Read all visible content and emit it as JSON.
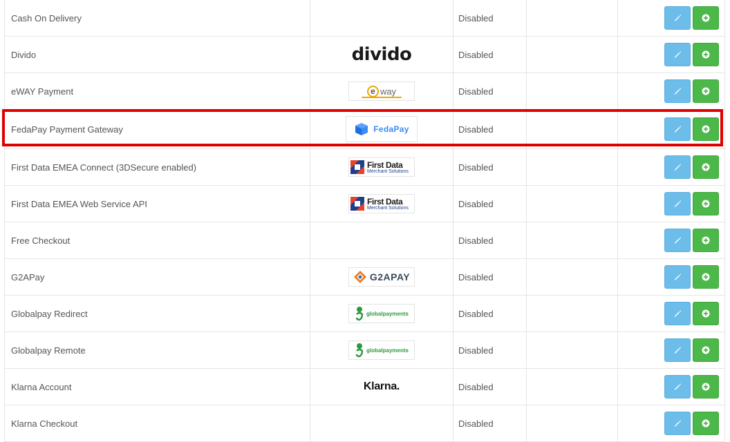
{
  "colors": {
    "edit_button": "#6cbde9",
    "install_button": "#4cb849",
    "highlight": "#e00000"
  },
  "rows": [
    {
      "name": "Cash On Delivery",
      "logo": "",
      "status": "Disabled"
    },
    {
      "name": "Divido",
      "logo": "divido",
      "status": "Disabled"
    },
    {
      "name": "eWAY Payment",
      "logo": "eway",
      "status": "Disabled"
    },
    {
      "name": "FedaPay Payment Gateway",
      "logo": "FedaPay",
      "status": "Disabled"
    },
    {
      "name": "First Data EMEA Connect (3DSecure enabled)",
      "logo": "First Data Merchant Solutions",
      "status": "Disabled"
    },
    {
      "name": "First Data EMEA Web Service API",
      "logo": "First Data Merchant Solutions",
      "status": "Disabled"
    },
    {
      "name": "Free Checkout",
      "logo": "",
      "status": "Disabled"
    },
    {
      "name": "G2APay",
      "logo": "G2APAY",
      "status": "Disabled"
    },
    {
      "name": "Globalpay Redirect",
      "logo": "globalpayments",
      "status": "Disabled"
    },
    {
      "name": "Globalpay Remote",
      "logo": "globalpayments",
      "status": "Disabled"
    },
    {
      "name": "Klarna Account",
      "logo": "Klarna.",
      "status": "Disabled"
    },
    {
      "name": "Klarna Checkout",
      "logo": "",
      "status": "Disabled"
    }
  ],
  "logos": {
    "divido": "divido",
    "eway_e": "e",
    "eway_way": "way",
    "fedapay": "FedaPay",
    "firstdata_title": "First Data",
    "firstdata_sub": "Merchant Solutions",
    "g2apay": "G2APAY",
    "globalpayments": "globalpayments",
    "klarna": "Klarna."
  }
}
